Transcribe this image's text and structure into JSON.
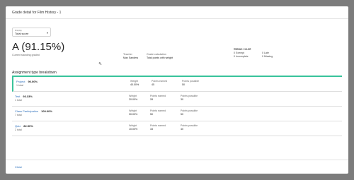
{
  "modal": {
    "title": "Grade detail for Film History - 1"
  },
  "display": {
    "label": "Display",
    "value": "Total score"
  },
  "grade": {
    "value": "A (91.15%)",
    "subtitle": "Current standing graded"
  },
  "teacher": {
    "label": "Teacher",
    "value": "Max Sanders"
  },
  "calculation": {
    "label": "Grade calculation",
    "value": "Total points with weight"
  },
  "status_count": {
    "title": "Status count",
    "items": [
      {
        "count": "0",
        "label": "Exempt"
      },
      {
        "count": "0",
        "label": "Late"
      },
      {
        "count": "0",
        "label": "Incomplete"
      },
      {
        "count": "0",
        "label": "Missing"
      }
    ]
  },
  "breakdown": {
    "title": "Assignment type breakdown",
    "col_labels": {
      "weight": "Weight",
      "earned": "Points earned",
      "possible": "Points possible"
    },
    "rows": [
      {
        "name": "Project",
        "pct": "90.00%",
        "count": "1 total",
        "weight": "40.00%",
        "earned": "45",
        "possible": "50"
      },
      {
        "name": "Test",
        "pct": "93.33%",
        "count": "1 total",
        "weight": "20.00%",
        "earned": "28",
        "possible": "30"
      },
      {
        "name": "Class Participation",
        "pct": "100.00%",
        "count": "7 total",
        "weight": "30.00%",
        "earned": "50",
        "possible": "50"
      },
      {
        "name": "Quiz",
        "pct": "82.50%",
        "count": "2 total",
        "weight": "10.00%",
        "earned": "33",
        "possible": "40"
      }
    ]
  },
  "footer": {
    "close_label": "Close"
  },
  "colors": {
    "accent": "#39c39b",
    "link": "#2a6ebb",
    "backdrop": "#7c7c7c"
  }
}
